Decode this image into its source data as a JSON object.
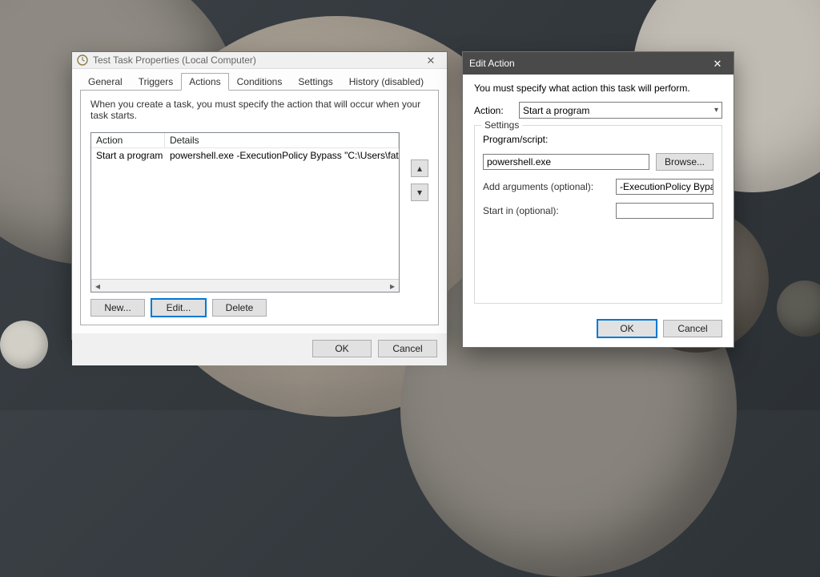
{
  "propertiesWindow": {
    "title": "Test Task Properties (Local Computer)",
    "tabs": {
      "general": "General",
      "triggers": "Triggers",
      "actions": "Actions",
      "conditions": "Conditions",
      "settings": "Settings",
      "history": "History (disabled)"
    },
    "activeTab": "actions",
    "hint": "When you create a task, you must specify the action that will occur when your task starts.",
    "columns": {
      "action": "Action",
      "details": "Details"
    },
    "rows": [
      {
        "action": "Start a program",
        "details": "powershell.exe -ExecutionPolicy Bypass \"C:\\Users\\fatiw\\Desktop\\endTask."
      }
    ],
    "buttons": {
      "new": "New...",
      "edit": "Edit...",
      "delete": "Delete",
      "ok": "OK",
      "cancel": "Cancel"
    },
    "orderUp": "▴",
    "orderDown": "▾"
  },
  "editAction": {
    "title": "Edit Action",
    "intro": "You must specify what action this task will perform.",
    "actionLabel": "Action:",
    "actionValue": "Start a program",
    "settingsLegend": "Settings",
    "programLabel": "Program/script:",
    "programValue": "powershell.exe",
    "browse": "Browse...",
    "argsLabel": "Add arguments (optional):",
    "argsValue": "-ExecutionPolicy Bypass",
    "startInLabel": "Start in (optional):",
    "startInValue": "",
    "ok": "OK",
    "cancel": "Cancel"
  }
}
